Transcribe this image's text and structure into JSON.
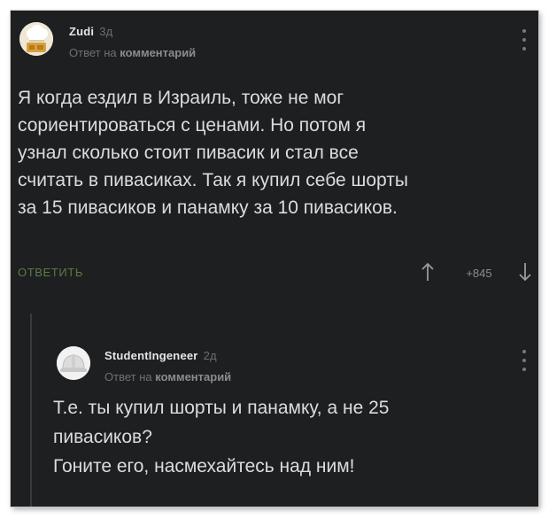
{
  "comments": [
    {
      "user": "Zudi",
      "time": "3д",
      "reply_prefix": "Ответ на",
      "reply_target": "комментарий",
      "text": "Я когда ездил в Израиль, тоже не мог\nсориентироваться с ценами. Но потом я\nузнал сколько стоит пивасик и стал все\nсчитать в пивасиках. Так я купил себе шорты\nза 15 пивасиков и панамку за 10 пивасиков.",
      "reply_label": "ОТВЕТИТЬ",
      "score": "+845",
      "avatar_icon": "chef-hat-avatar-icon"
    },
    {
      "user": "StudentIngeneer",
      "time": "2д",
      "reply_prefix": "Ответ на",
      "reply_target": "комментарий",
      "text": "Т.е. ты купил шорты и панамку, а не 25\nпивасиков?\nГоните его, насмехайтесь над ним!",
      "avatar_icon": "hard-hat-avatar-icon"
    }
  ],
  "colors": {
    "background": "#1e1f21",
    "text": "#dcdcdc",
    "reply_button": "#5d7a43",
    "muted": "#6f7073"
  }
}
